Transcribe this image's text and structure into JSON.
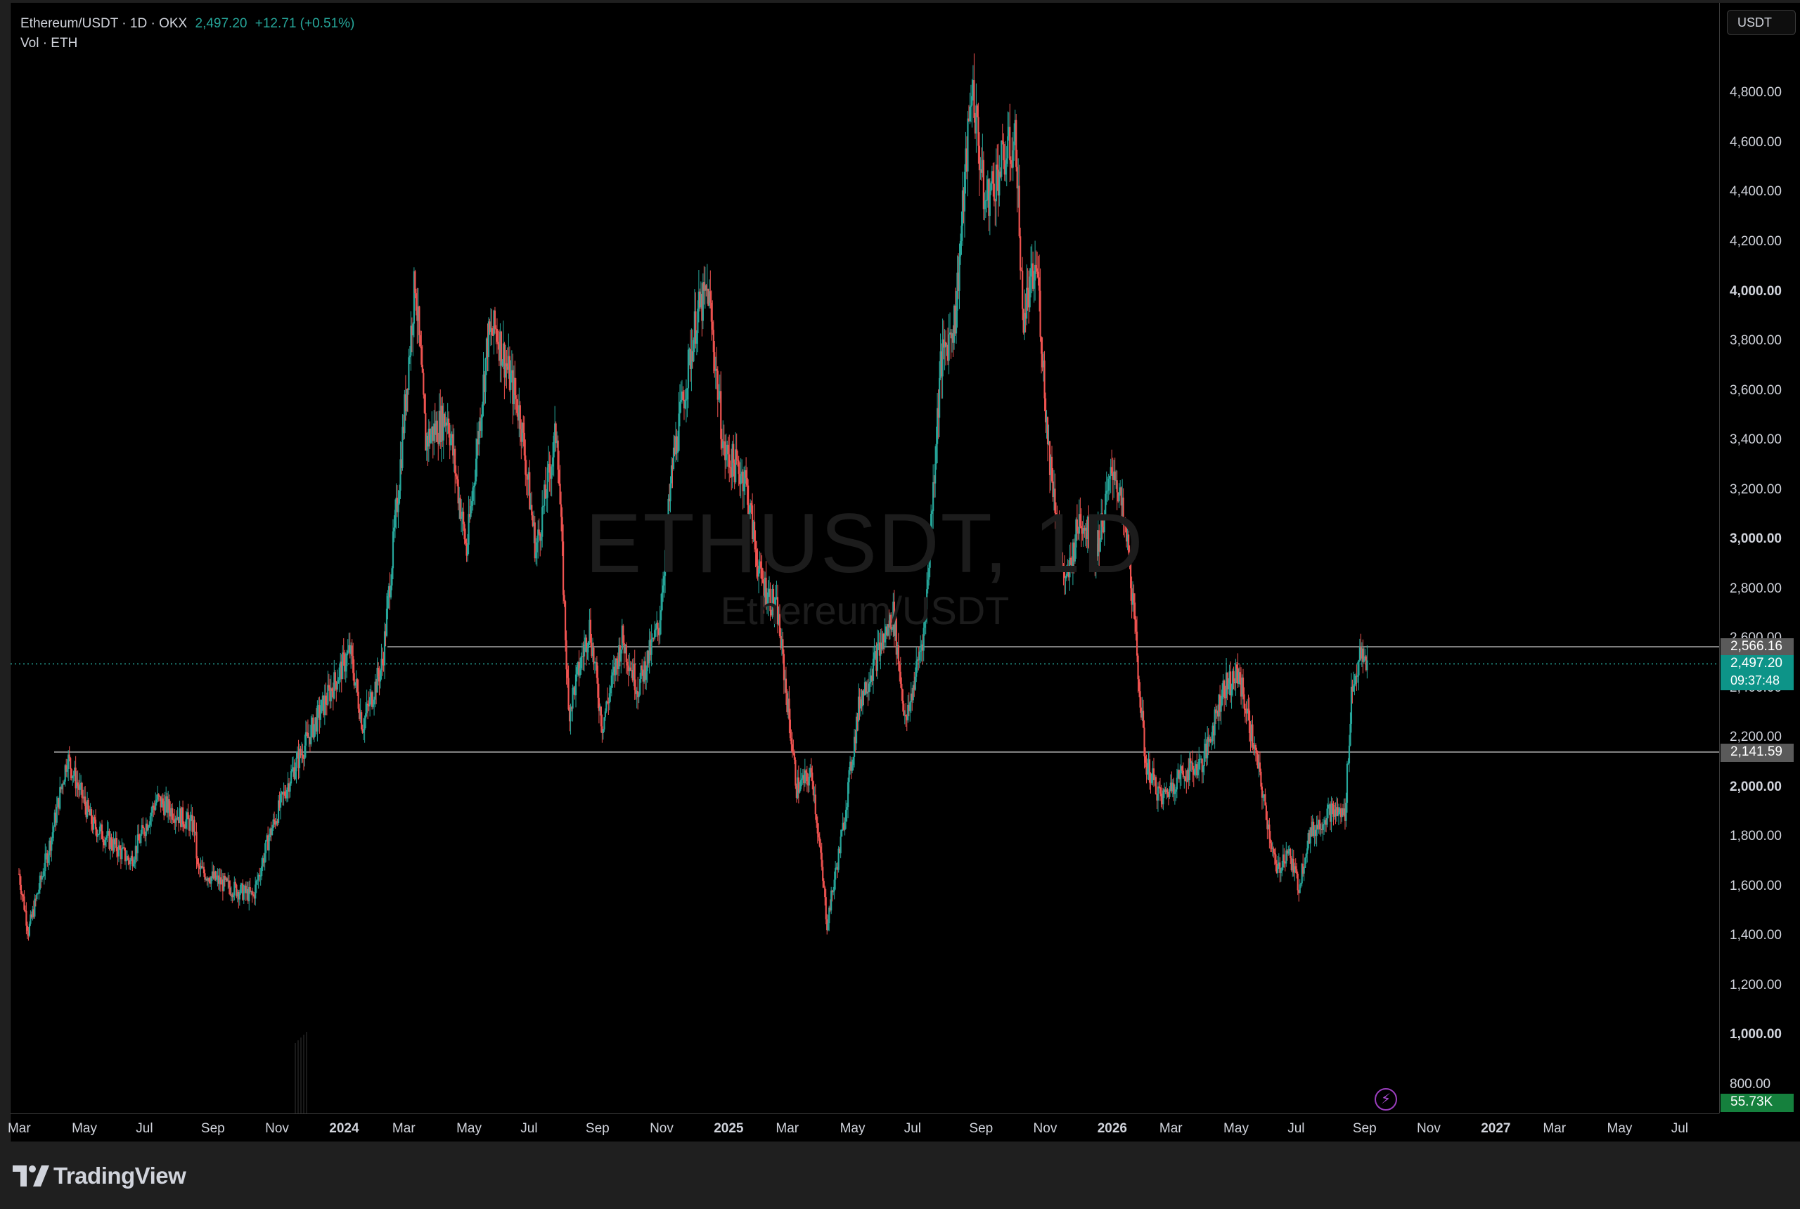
{
  "legend": {
    "symbol": "Ethereum/USDT · 1D · OKX",
    "price": "2,497.20",
    "change": "+12.71 (+0.51%)",
    "volume_label": "Vol · ETH"
  },
  "watermark": {
    "ticker": "ETHUSDT, 1D",
    "name": "Ethereum/USDT"
  },
  "currency_button": "USDT",
  "price_axis": {
    "ticks": [
      "4,800.00",
      "4,600.00",
      "4,400.00",
      "4,200.00",
      "4,000.00",
      "3,800.00",
      "3,600.00",
      "3,400.00",
      "3,200.00",
      "3,000.00",
      "2,800.00",
      "2,600.00",
      "2,400.00",
      "2,200.00",
      "2,000.00",
      "1,800.00",
      "1,600.00",
      "1,400.00",
      "1,200.00",
      "1,000.00",
      "800.00"
    ],
    "bold_ticks": [
      "4,000.00",
      "3,000.00",
      "2,000.00",
      "1,000.00"
    ]
  },
  "time_axis": {
    "labels": [
      "Mar",
      "May",
      "Jul",
      "Sep",
      "Nov",
      "2024",
      "Mar",
      "May",
      "Jul",
      "Sep",
      "Nov",
      "2025",
      "Mar",
      "May",
      "Jul",
      "Sep",
      "Nov",
      "2026",
      "Mar",
      "May",
      "Jul",
      "Sep",
      "Nov",
      "2027",
      "Mar",
      "May",
      "Jul"
    ],
    "bold_labels": [
      "2024",
      "2025",
      "2026",
      "2027"
    ]
  },
  "horizontal_lines": {
    "upper": "2,566.16",
    "lower": "2,141.59"
  },
  "last_price_tag": {
    "price": "2,497.20",
    "countdown": "09:37:48"
  },
  "volume_tag": "55.73K",
  "footer": {
    "brand": "TradingView"
  },
  "colors": {
    "up": "#26a69a",
    "down": "#ef5350",
    "background": "#000000",
    "price_tag": "#0d9488",
    "volume_tag": "#15803d",
    "line_tag": "#5a5a5a"
  },
  "chart_data": {
    "type": "candlestick",
    "title": "Ethereum/USDT · 1D · OKX",
    "ylim": [
      700,
      5000
    ],
    "y_ticks": [
      800,
      1000,
      1200,
      1400,
      1600,
      1800,
      2000,
      2200,
      2400,
      2600,
      2800,
      3000,
      3200,
      3400,
      3600,
      3800,
      4000,
      4200,
      4400,
      4600,
      4800
    ],
    "x_range": [
      "2023-03",
      "2027-07"
    ],
    "reference_lines": [
      2566.16,
      2141.59
    ],
    "last_price": 2497.2,
    "close_anchors": [
      [
        "2023-03-01",
        1650
      ],
      [
        "2023-03-10",
        1420
      ],
      [
        "2023-04-01",
        1800
      ],
      [
        "2023-04-16",
        2120
      ],
      [
        "2023-05-10",
        1850
      ],
      [
        "2023-06-15",
        1700
      ],
      [
        "2023-07-10",
        1950
      ],
      [
        "2023-08-15",
        1840
      ],
      [
        "2023-08-18",
        1670
      ],
      [
        "2023-09-15",
        1600
      ],
      [
        "2023-10-10",
        1560
      ],
      [
        "2023-10-25",
        1800
      ],
      [
        "2023-11-15",
        2050
      ],
      [
        "2023-12-10",
        2280
      ],
      [
        "2024-01-10",
        2550
      ],
      [
        "2024-01-22",
        2250
      ],
      [
        "2024-02-10",
        2500
      ],
      [
        "2024-02-25",
        3200
      ],
      [
        "2024-03-12",
        4050
      ],
      [
        "2024-03-22",
        3400
      ],
      [
        "2024-04-12",
        3500
      ],
      [
        "2024-04-30",
        2950
      ],
      [
        "2024-05-20",
        3800
      ],
      [
        "2024-05-28",
        3850
      ],
      [
        "2024-06-20",
        3500
      ],
      [
        "2024-07-05",
        2950
      ],
      [
        "2024-07-25",
        3450
      ],
      [
        "2024-08-05",
        2300
      ],
      [
        "2024-08-25",
        2650
      ],
      [
        "2024-09-06",
        2250
      ],
      [
        "2024-09-25",
        2600
      ],
      [
        "2024-10-10",
        2400
      ],
      [
        "2024-10-30",
        2650
      ],
      [
        "2024-11-12",
        3300
      ],
      [
        "2024-12-05",
        3900
      ],
      [
        "2024-12-16",
        4000
      ],
      [
        "2024-12-31",
        3350
      ],
      [
        "2025-01-20",
        3250
      ],
      [
        "2025-02-03",
        2850
      ],
      [
        "2025-02-20",
        2700
      ],
      [
        "2025-03-10",
        2000
      ],
      [
        "2025-03-25",
        2050
      ],
      [
        "2025-04-08",
        1450
      ],
      [
        "2025-04-22",
        1800
      ],
      [
        "2025-05-09",
        2350
      ],
      [
        "2025-06-10",
        2700
      ],
      [
        "2025-06-22",
        2250
      ],
      [
        "2025-07-10",
        2650
      ],
      [
        "2025-07-25",
        3700
      ],
      [
        "2025-08-08",
        3900
      ],
      [
        "2025-08-24",
        4850
      ],
      [
        "2025-09-05",
        4350
      ],
      [
        "2025-09-25",
        4550
      ],
      [
        "2025-10-05",
        4600
      ],
      [
        "2025-10-11",
        3900
      ],
      [
        "2025-10-25",
        4100
      ],
      [
        "2025-11-04",
        3400
      ],
      [
        "2025-11-21",
        2800
      ],
      [
        "2025-12-05",
        3100
      ],
      [
        "2025-12-20",
        2950
      ],
      [
        "2026-01-06",
        3300
      ],
      [
        "2026-01-20",
        2950
      ],
      [
        "2026-02-05",
        2100
      ],
      [
        "2026-02-20",
        1950
      ],
      [
        "2026-03-10",
        2050
      ],
      [
        "2026-04-01",
        2100
      ],
      [
        "2026-04-20",
        2400
      ],
      [
        "2026-05-05",
        2450
      ],
      [
        "2026-05-20",
        2150
      ],
      [
        "2026-06-10",
        1650
      ],
      [
        "2026-06-20",
        1750
      ],
      [
        "2026-07-01",
        1600
      ],
      [
        "2026-07-10",
        1800
      ],
      [
        "2026-07-30",
        1900
      ],
      [
        "2026-08-14",
        1890
      ],
      [
        "2026-08-20",
        2380
      ],
      [
        "2026-08-28",
        2520
      ],
      [
        "2026-09-05",
        2497
      ]
    ]
  }
}
